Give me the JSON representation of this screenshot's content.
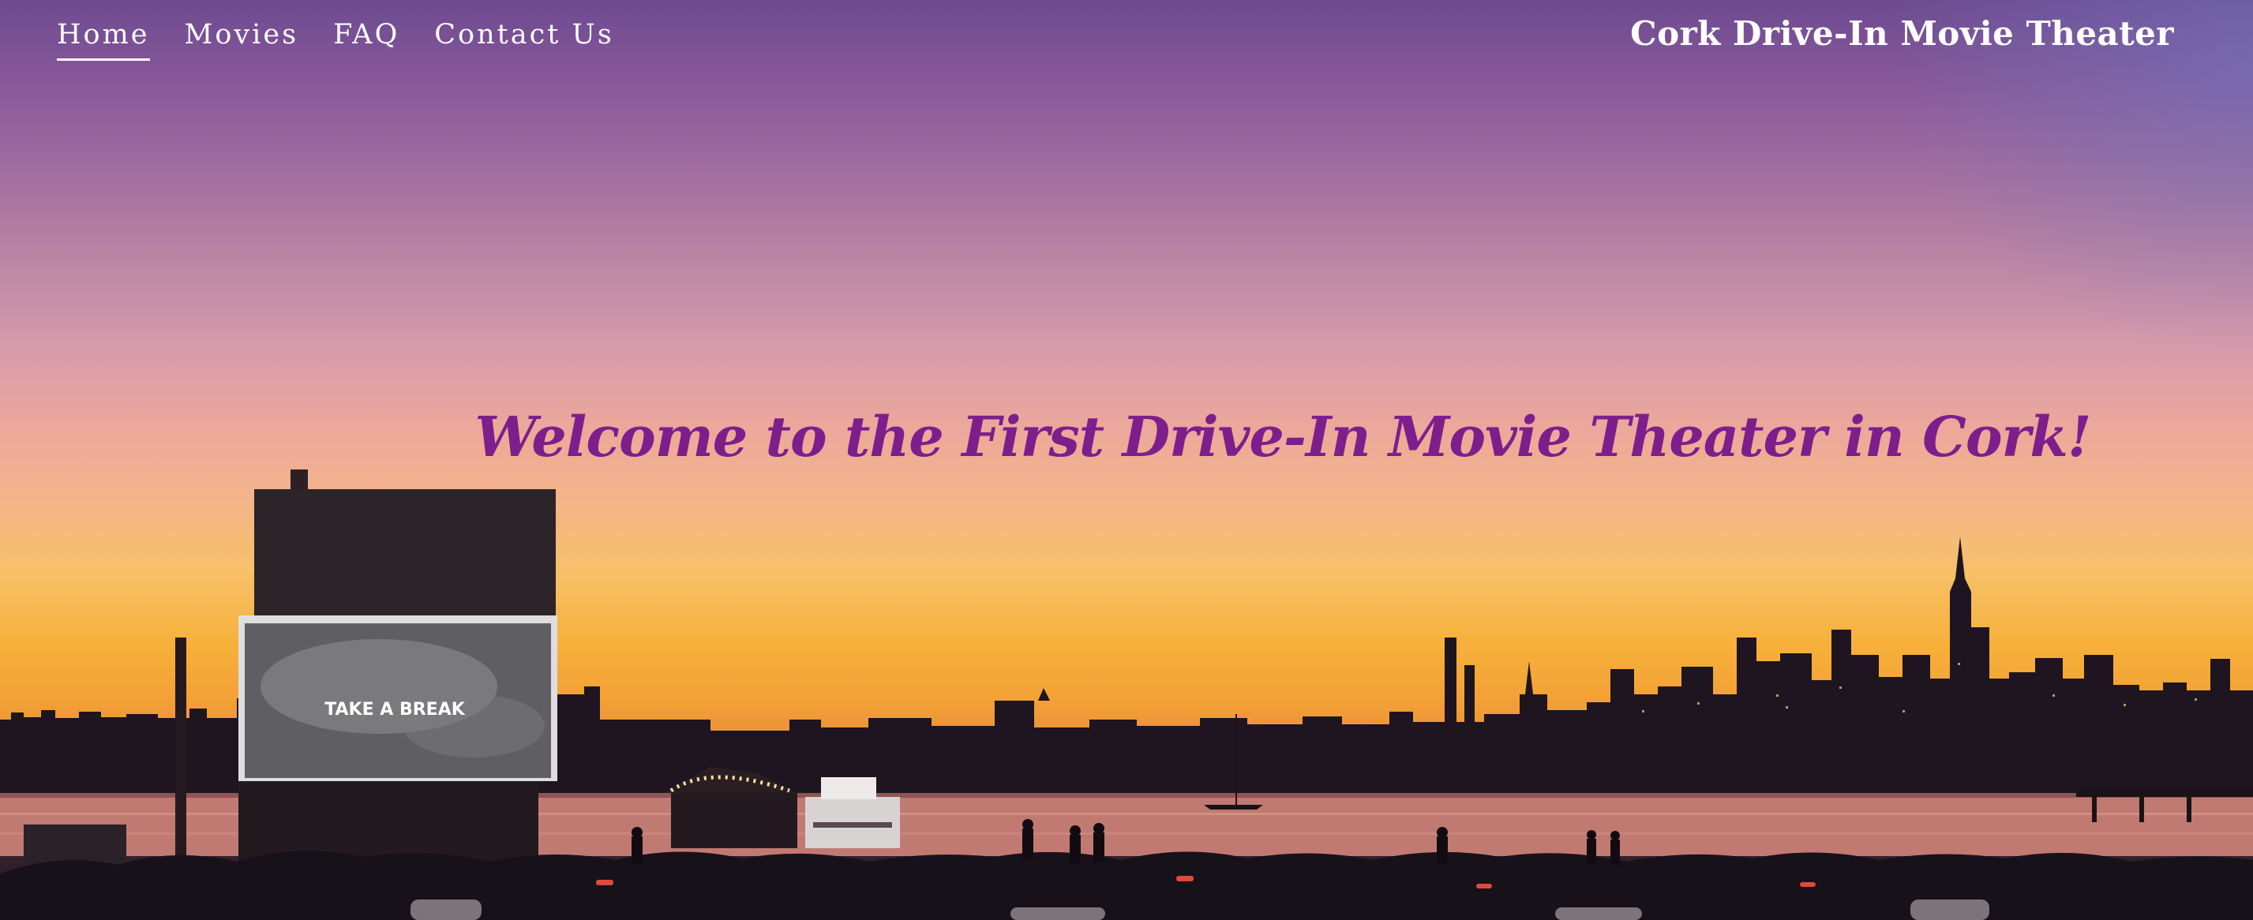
{
  "nav": {
    "items": [
      {
        "label": "Home",
        "active": true
      },
      {
        "label": "Movies",
        "active": false
      },
      {
        "label": "FAQ",
        "active": false
      },
      {
        "label": "Contact Us",
        "active": false
      }
    ]
  },
  "site_title": "Cork Drive-In Movie Theater",
  "hero": {
    "headline": "Welcome to the First Drive-In Movie Theater in Cork!",
    "screen_text": "TAKE A BREAK",
    "text_color": "#7e1e8c"
  }
}
